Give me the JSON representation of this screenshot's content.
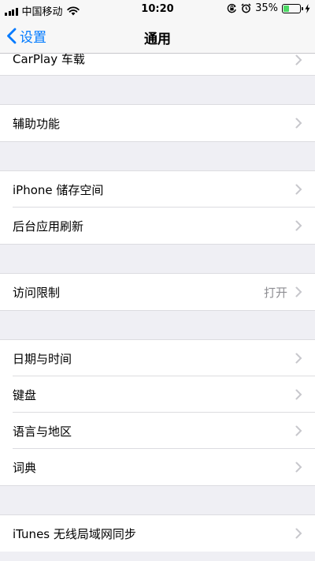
{
  "status_bar": {
    "carrier": "中国移动",
    "time": "10:20",
    "battery_percent": "35%",
    "battery_level": 0.35,
    "icons": [
      "signal-icon",
      "wifi-icon",
      "orientation-lock-icon",
      "alarm-icon",
      "battery-icon",
      "charging-icon"
    ]
  },
  "nav": {
    "back_label": "设置",
    "title": "通用"
  },
  "groups": [
    {
      "items": [
        {
          "label": "CarPlay 车载"
        }
      ]
    },
    {
      "items": [
        {
          "label": "辅助功能"
        }
      ]
    },
    {
      "items": [
        {
          "label": "iPhone 储存空间"
        },
        {
          "label": "后台应用刷新"
        }
      ]
    },
    {
      "items": [
        {
          "label": "访问限制",
          "value": "打开"
        }
      ]
    },
    {
      "items": [
        {
          "label": "日期与时间"
        },
        {
          "label": "键盘"
        },
        {
          "label": "语言与地区"
        },
        {
          "label": "词典"
        }
      ]
    },
    {
      "items": [
        {
          "label": "iTunes 无线局域网同步"
        }
      ]
    }
  ],
  "colors": {
    "accent": "#007aff",
    "background": "#efeff4",
    "secondary_text": "#8e8e93",
    "battery": "#4cd964"
  }
}
